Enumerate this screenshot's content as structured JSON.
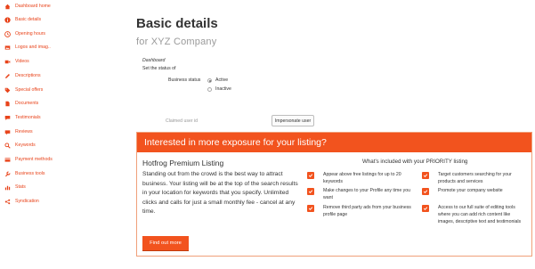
{
  "sidebar": {
    "items": [
      {
        "label": "Dashboard home",
        "icon": "home-icon"
      },
      {
        "label": "Basic details",
        "icon": "info-icon"
      },
      {
        "label": "Opening hours",
        "icon": "clock-icon"
      },
      {
        "label": "Logos and imag..",
        "icon": "image-icon"
      },
      {
        "label": "Videos",
        "icon": "video-icon"
      },
      {
        "label": "Descriptions",
        "icon": "pencil-icon"
      },
      {
        "label": "Special offers",
        "icon": "tag-icon"
      },
      {
        "label": "Documents",
        "icon": "document-icon"
      },
      {
        "label": "Testimonials",
        "icon": "speech-icon"
      },
      {
        "label": "Reviews",
        "icon": "review-icon"
      },
      {
        "label": "Keywords",
        "icon": "keyword-icon"
      },
      {
        "label": "Payment methods",
        "icon": "card-icon"
      },
      {
        "label": "Business tools",
        "icon": "wrench-icon"
      },
      {
        "label": "Stats",
        "icon": "chart-icon"
      },
      {
        "label": "Syndication",
        "icon": "syndication-icon"
      }
    ]
  },
  "header": {
    "title": "Basic details",
    "subtitle": "for XYZ Company"
  },
  "form": {
    "breadcrumb": "Dashboard",
    "status_hint": "Set the status of",
    "business_status_label": "Business status",
    "options": [
      {
        "label": "Active",
        "selected": true
      },
      {
        "label": "Inactive",
        "selected": false
      }
    ],
    "claimed_user_label": "Claimed user id",
    "impersonate_label": "Impersonate user"
  },
  "promo": {
    "header": "Interested in more exposure for your listing?",
    "title": "Hotfrog Premium Listing",
    "body": "Standing out from the crowd is the best way to attract business. Your listing will be at the top of the search results in your location for keywords that you specify. Unlimited clicks and calls for just a small monthly fee - cancel at any time.",
    "button_label": "Find out more",
    "included_title": "What's included with your PRIORITY listing",
    "features": [
      "Appear above free listings for up to 20 keywords",
      "Target customers searching for your products and services",
      "Make changes to your Profile any time you want",
      "Promote your company website",
      "Remove third party ads from your business profile page",
      "Access to our full suite of editing tools where you can add rich content like images, descriptive text and testimonials"
    ]
  },
  "colors": {
    "accent": "#f2531e",
    "link": "#e8431a"
  }
}
